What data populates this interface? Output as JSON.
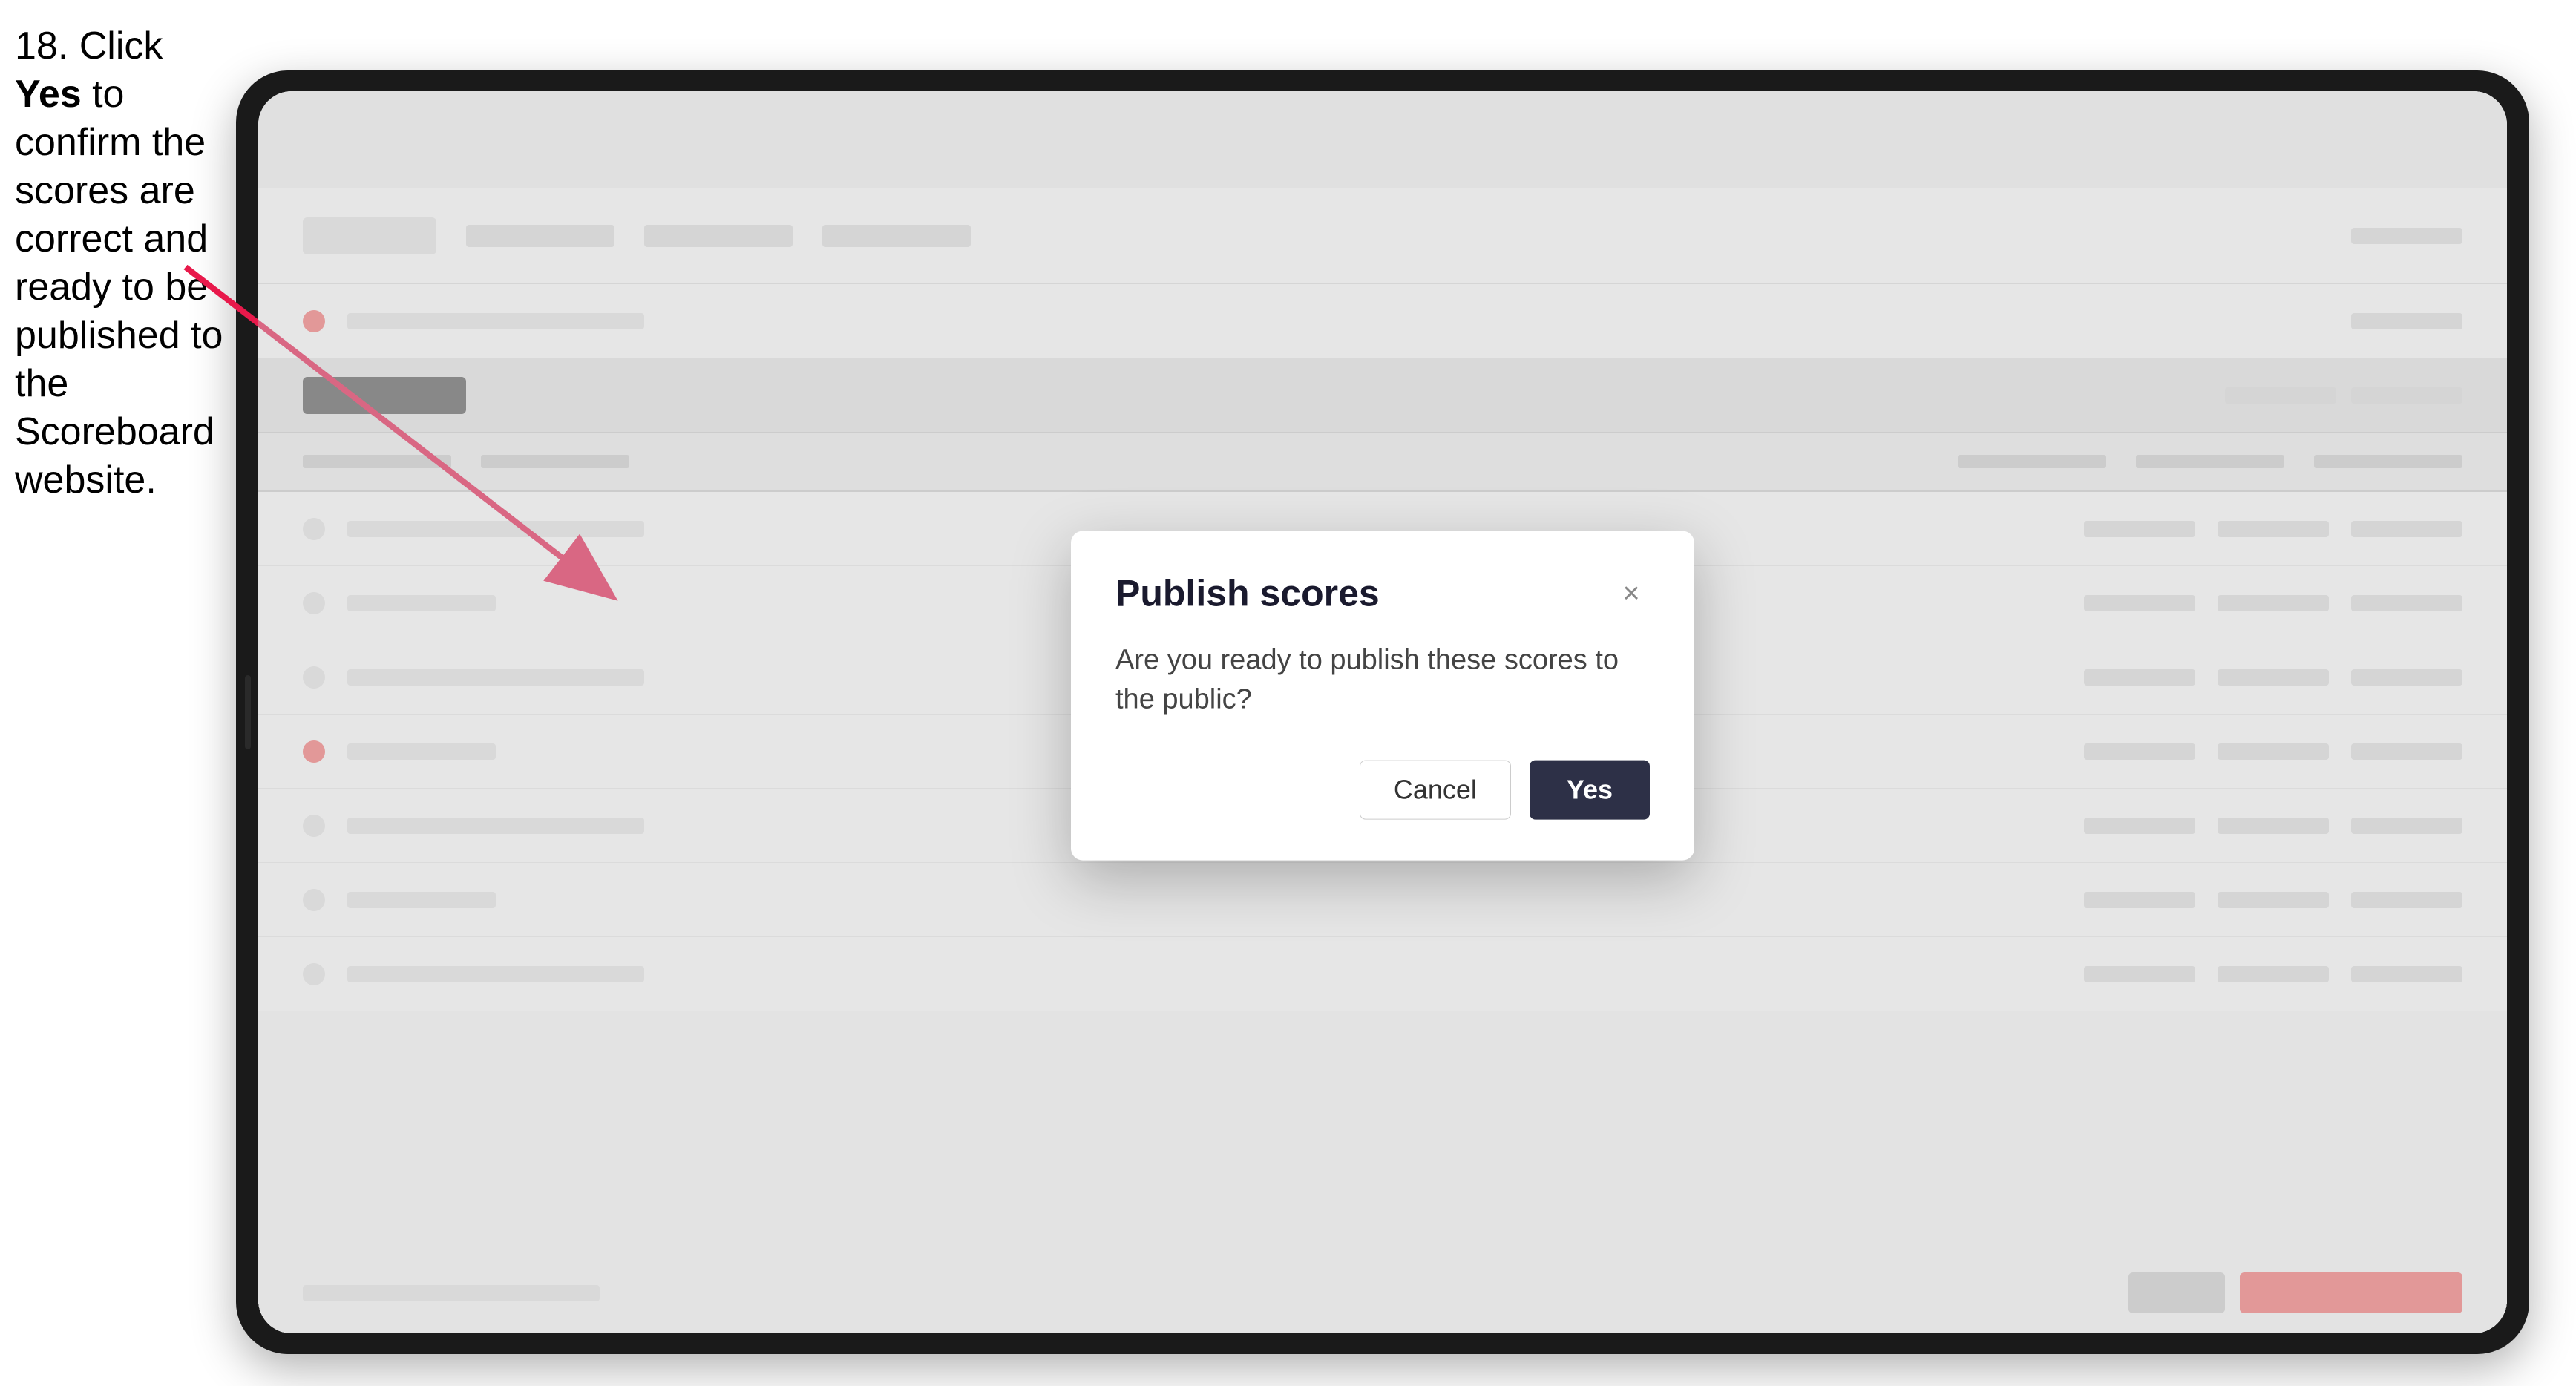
{
  "instruction": {
    "step": "18.",
    "text_before_bold": " Click ",
    "bold_word": "Yes",
    "text_after": " to confirm the scores are correct and ready to be published to the Scoreboard website."
  },
  "app": {
    "rows": [
      {
        "type": "content",
        "highlighted": false
      },
      {
        "type": "content",
        "highlighted": false
      },
      {
        "type": "action"
      },
      {
        "type": "col-headers"
      },
      {
        "type": "content",
        "highlighted": false
      },
      {
        "type": "content",
        "highlighted": false
      },
      {
        "type": "content",
        "highlighted": false
      },
      {
        "type": "content",
        "highlighted": false
      },
      {
        "type": "content",
        "highlighted": false
      },
      {
        "type": "content",
        "highlighted": false
      },
      {
        "type": "content",
        "highlighted": false
      }
    ]
  },
  "modal": {
    "title": "Publish scores",
    "close_label": "×",
    "body_text": "Are you ready to publish these scores to the public?",
    "cancel_label": "Cancel",
    "yes_label": "Yes"
  }
}
